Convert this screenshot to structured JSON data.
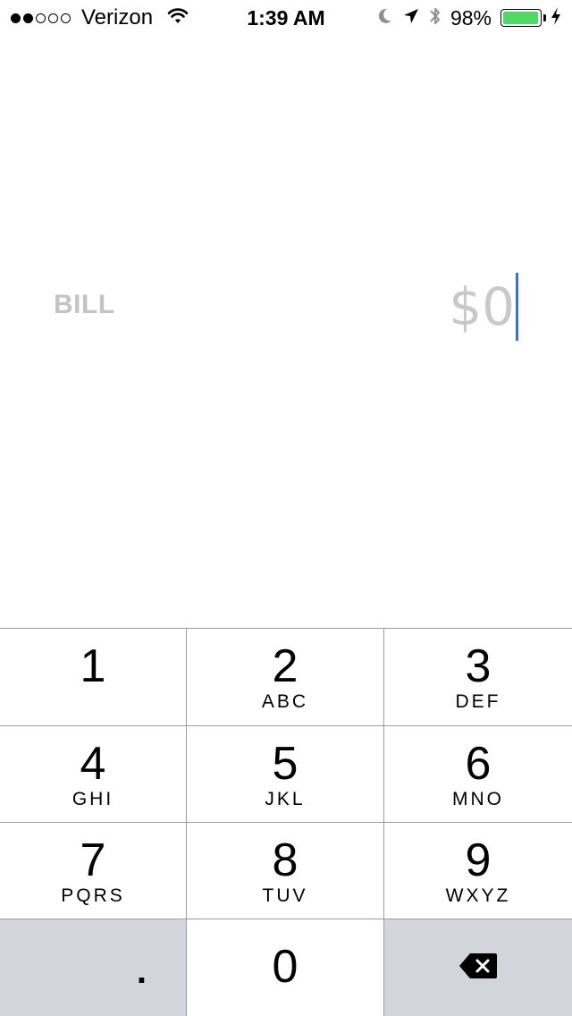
{
  "status_bar": {
    "carrier": "Verizon",
    "signal_bars_filled": 2,
    "signal_bars_total": 5,
    "time": "1:39 AM",
    "battery_percent": "98%",
    "battery_level": 0.98,
    "battery_color": "#4cd964"
  },
  "bill": {
    "label": "BILL",
    "amount": "$0",
    "cursor_color": "#3b6fd8"
  },
  "keypad": {
    "keys": [
      {
        "num": "1",
        "letters": ""
      },
      {
        "num": "2",
        "letters": "ABC"
      },
      {
        "num": "3",
        "letters": "DEF"
      },
      {
        "num": "4",
        "letters": "GHI"
      },
      {
        "num": "5",
        "letters": "JKL"
      },
      {
        "num": "6",
        "letters": "MNO"
      },
      {
        "num": "7",
        "letters": "PQRS"
      },
      {
        "num": "8",
        "letters": "TUV"
      },
      {
        "num": "9",
        "letters": "WXYZ"
      }
    ],
    "decimal": ".",
    "zero": "0",
    "delete_icon": "backspace-icon"
  }
}
